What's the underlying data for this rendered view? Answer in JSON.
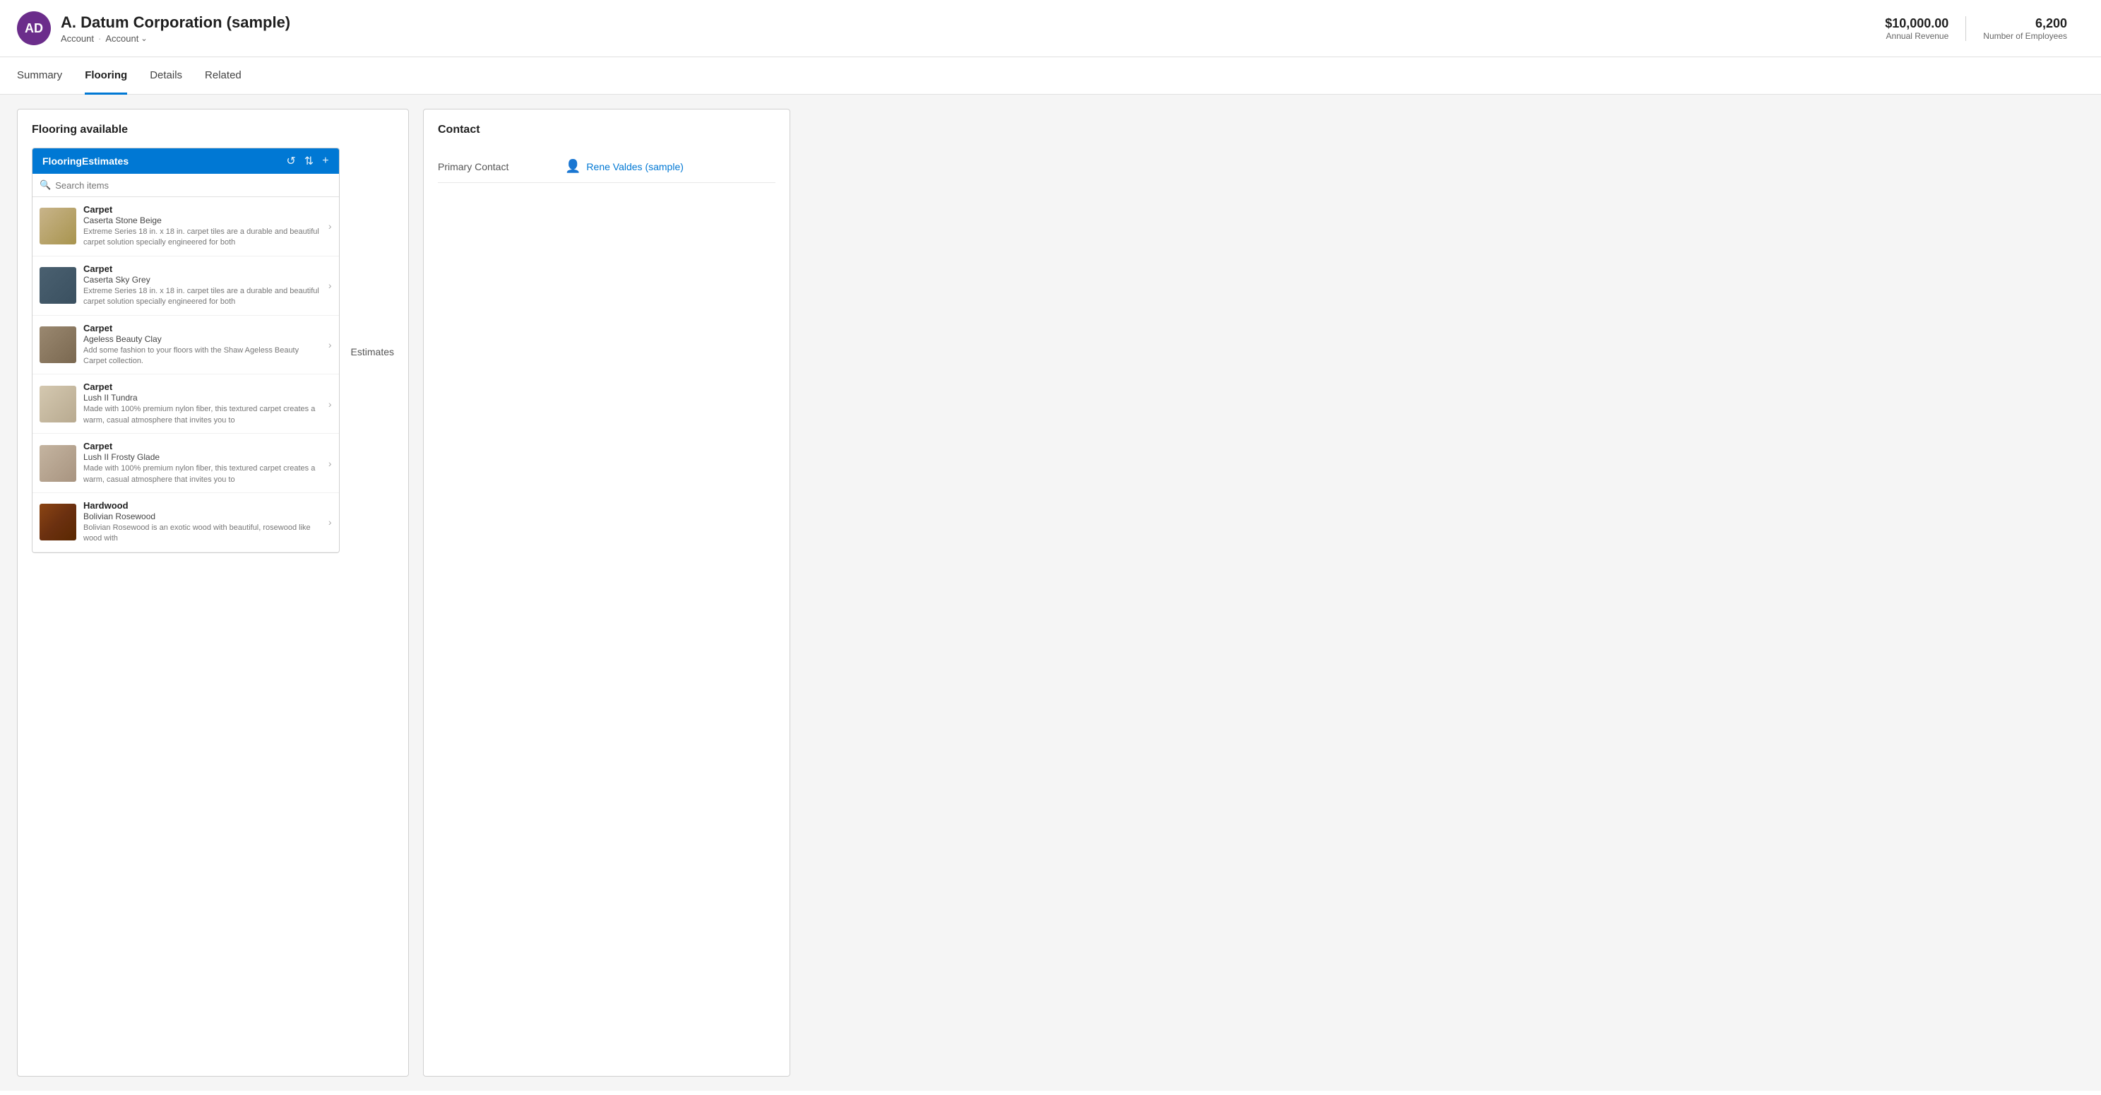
{
  "header": {
    "avatar_initials": "AD",
    "title": "A. Datum Corporation (sample)",
    "breadcrumb1": "Account",
    "breadcrumb2": "Account",
    "annual_revenue_label": "Annual Revenue",
    "annual_revenue_value": "$10,000.00",
    "employees_label": "Number of Employees",
    "employees_value": "6,200"
  },
  "nav": {
    "tabs": [
      {
        "id": "summary",
        "label": "Summary"
      },
      {
        "id": "flooring",
        "label": "Flooring"
      },
      {
        "id": "details",
        "label": "Details"
      },
      {
        "id": "related",
        "label": "Related"
      }
    ],
    "active_tab": "flooring"
  },
  "left_panel": {
    "title": "Flooring available",
    "subpanel_title": "FlooringEstimates",
    "search_placeholder": "Search items",
    "side_label": "Estimates",
    "items": [
      {
        "id": "carpet-beige",
        "category": "Carpet",
        "name": "Caserta Stone Beige",
        "description": "Extreme Series 18 in. x 18 in. carpet tiles are a durable and beautiful carpet solution specially engineered for both",
        "thumb_class": "item-thumb-carpet-beige"
      },
      {
        "id": "carpet-grey",
        "category": "Carpet",
        "name": "Caserta Sky Grey",
        "description": "Extreme Series 18 in. x 18 in. carpet tiles are a durable and beautiful carpet solution specially engineered for both",
        "thumb_class": "item-thumb-carpet-grey"
      },
      {
        "id": "carpet-clay",
        "category": "Carpet",
        "name": "Ageless Beauty Clay",
        "description": "Add some fashion to your floors with the Shaw Ageless Beauty Carpet collection.",
        "thumb_class": "item-thumb-carpet-clay"
      },
      {
        "id": "carpet-tundra",
        "category": "Carpet",
        "name": "Lush II Tundra",
        "description": "Made with 100% premium nylon fiber, this textured carpet creates a warm, casual atmosphere that invites you to",
        "thumb_class": "item-thumb-carpet-tundra"
      },
      {
        "id": "carpet-frosty",
        "category": "Carpet",
        "name": "Lush II Frosty Glade",
        "description": "Made with 100% premium nylon fiber, this textured carpet creates a warm, casual atmosphere that invites you to",
        "thumb_class": "item-thumb-carpet-frosty"
      },
      {
        "id": "hardwood",
        "category": "Hardwood",
        "name": "Bolivian Rosewood",
        "description": "Bolivian Rosewood is an exotic wood with beautiful, rosewood like wood with",
        "thumb_class": "item-thumb-hardwood"
      }
    ]
  },
  "right_panel": {
    "title": "Contact",
    "primary_contact_label": "Primary Contact",
    "primary_contact_value": "Rene Valdes (sample)"
  },
  "icons": {
    "refresh": "↺",
    "sort": "⇅",
    "add": "+",
    "search": "🔍",
    "chevron_right": "›",
    "person": "👤",
    "chevron_down": "⌄"
  }
}
